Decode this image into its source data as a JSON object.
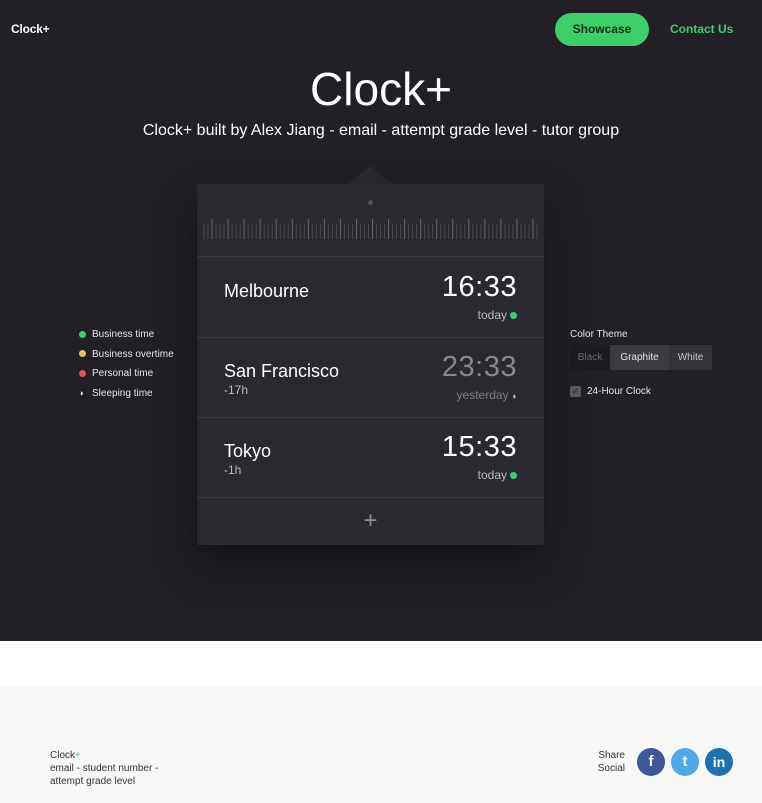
{
  "nav": {
    "brand": "Clock+",
    "showcase": "Showcase",
    "contact": "Contact Us"
  },
  "hero": {
    "title": "Clock+",
    "subtitle": "Clock+ built by Alex Jiang - email - attempt grade level - tutor group"
  },
  "clocks": [
    {
      "city": "Melbourne",
      "offset": "",
      "time": "16:33",
      "day": "today",
      "status": "business"
    },
    {
      "city": "San Francisco",
      "offset": "-17h",
      "time": "23:33",
      "day": "yesterday",
      "status": "sleeping"
    },
    {
      "city": "Tokyo",
      "offset": "-1h",
      "time": "15:33",
      "day": "today",
      "status": "business"
    }
  ],
  "add_label": "+",
  "legend": [
    {
      "label": "Business time",
      "color": "#3ccf6a",
      "icon": "dot"
    },
    {
      "label": "Business overtime",
      "color": "#e8c25a",
      "icon": "dot"
    },
    {
      "label": "Personal time",
      "color": "#e0505f",
      "icon": "dot"
    },
    {
      "label": "Sleeping time",
      "color": "#e7e6ea",
      "icon": "moon-icon"
    }
  ],
  "settings": {
    "theme_label": "Color Theme",
    "themes": [
      "Black",
      "Graphite",
      "White"
    ],
    "selected_theme": "Graphite",
    "checkbox_label": "24-Hour Clock",
    "checkbox_checked": true
  },
  "footer": {
    "brand": "Clock",
    "brand_plus": "+",
    "line2": "email - student number -",
    "line3": "attempt grade level",
    "share1": "Share",
    "share2": "Social"
  },
  "social": [
    {
      "name": "facebook",
      "glyph": "f",
      "color": "#3b5998"
    },
    {
      "name": "twitter",
      "glyph": "t",
      "color": "#4fa9e6"
    },
    {
      "name": "linkedin",
      "glyph": "in",
      "color": "#1e72b0"
    }
  ],
  "colors": {
    "accent": "#3ccf6a",
    "background": "#221f26",
    "card": "#2b2930"
  }
}
